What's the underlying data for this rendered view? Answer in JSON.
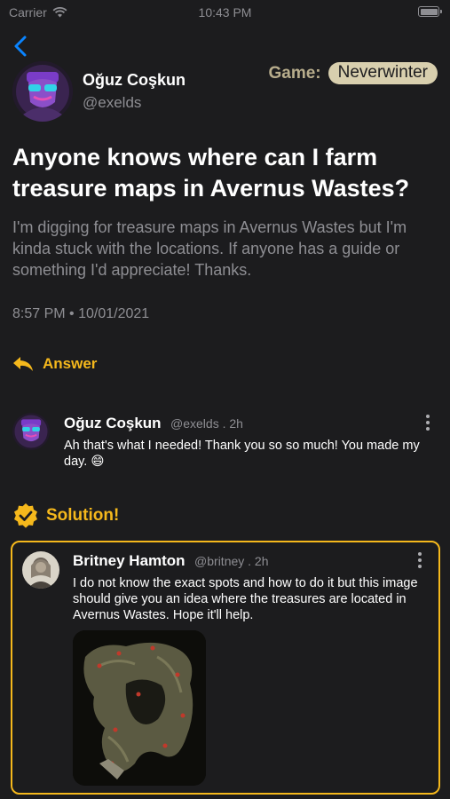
{
  "status_bar": {
    "carrier": "Carrier",
    "time": "10:43 PM"
  },
  "post": {
    "author": {
      "name": "Oğuz Coşkun",
      "handle": "@exelds"
    },
    "game": {
      "label": "Game:",
      "value": "Neverwinter"
    },
    "title": "Anyone knows where can I farm treasure maps in Avernus Wastes?",
    "body": "I'm digging for treasure maps in Avernus Wastes but I'm kinda stuck with the locations. If anyone has a guide or something I'd appreciate! Thanks.",
    "meta": "8:57 PM • 10/01/2021"
  },
  "answer_button": {
    "label": "Answer"
  },
  "comment": {
    "name": "Oğuz Coşkun",
    "handle": "@exelds .  2h",
    "text": "Ah that's what I needed! Thank you so so much! You made my day. 😄"
  },
  "solution": {
    "heading": "Solution!",
    "name": "Britney Hamton",
    "handle": "@britney .  2h",
    "text": "I do not know the exact spots and how to do it but this image should give you an idea where the treasures are located in Avernus Wastes. Hope it'll help."
  },
  "colors": {
    "accent": "#f5b81c",
    "background": "#1c1c1e",
    "secondary_text": "#8e8e93",
    "tag_background": "#d8cfae"
  },
  "icons": {
    "back": "chevron-left-icon",
    "answer": "reply-arrow-icon",
    "solution": "verified-badge-icon",
    "more": "more-vertical-icon"
  }
}
